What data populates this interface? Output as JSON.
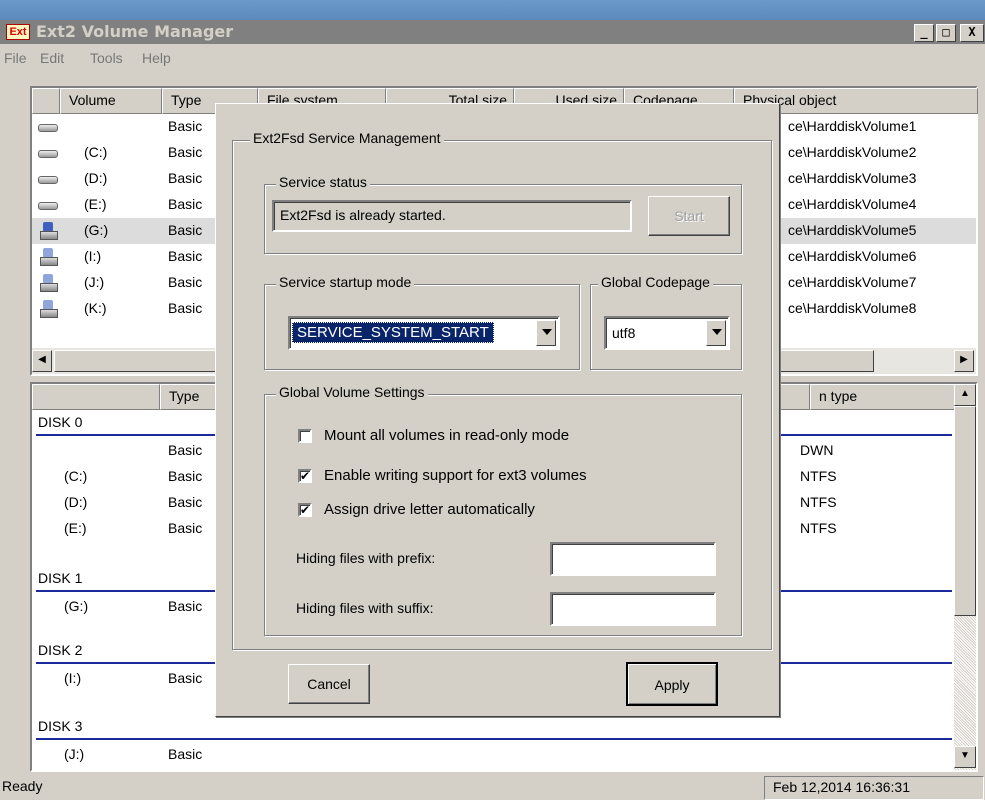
{
  "window": {
    "title": "Ext2 Volume Manager",
    "icon_text": "Ext"
  },
  "caption_buttons": {
    "minimize": "_",
    "maximize": "□",
    "close": "X"
  },
  "menu": [
    "File",
    "Edit",
    "Tools",
    "Help"
  ],
  "volume_table": {
    "headers": [
      "Volume",
      "Type",
      "File system",
      "Total size",
      "Used size",
      "Codepage",
      "Physical object"
    ],
    "rows": [
      {
        "volume": "",
        "type": "Basic",
        "physical": "ce\\HarddiskVolume1",
        "icon": "hard-disk-icon"
      },
      {
        "volume": "(C:)",
        "type": "Basic",
        "physical": "ce\\HarddiskVolume2",
        "icon": "hard-disk-icon"
      },
      {
        "volume": "(D:)",
        "type": "Basic",
        "physical": "ce\\HarddiskVolume3",
        "icon": "hard-disk-icon"
      },
      {
        "volume": "(E:)",
        "type": "Basic",
        "physical": "ce\\HarddiskVolume4",
        "icon": "hard-disk-icon"
      },
      {
        "volume": "(G:)",
        "type": "Basic",
        "physical": "ce\\HarddiskVolume5",
        "icon": "usb-disk-icon"
      },
      {
        "volume": "(I:)",
        "type": "Basic",
        "physical": "ce\\HarddiskVolume6",
        "icon": "usb-disk-icon"
      },
      {
        "volume": "(J:)",
        "type": "Basic",
        "physical": "ce\\HarddiskVolume7",
        "icon": "usb-disk-icon"
      },
      {
        "volume": "(K:)",
        "type": "Basic",
        "physical": "ce\\HarddiskVolume8",
        "icon": "usb-disk-icon"
      }
    ]
  },
  "disk_table": {
    "headers": [
      "",
      "Type",
      "",
      "n type"
    ],
    "disk0": "DISK 0",
    "disk1": "DISK 1",
    "disk2": "DISK 2",
    "disk3": "DISK 3",
    "rows": [
      {
        "name": "",
        "type": "Basic",
        "ptype": "DWN"
      },
      {
        "name": "(C:)",
        "type": "Basic",
        "ptype": "NTFS"
      },
      {
        "name": "(D:)",
        "type": "Basic",
        "ptype": "NTFS"
      },
      {
        "name": "(E:)",
        "type": "Basic",
        "ptype": "NTFS"
      },
      {
        "name": "(G:)",
        "type": "Basic",
        "ptype": ""
      },
      {
        "name": "(I:)",
        "type": "Basic",
        "ptype": ""
      },
      {
        "name": "(J:)",
        "type": "Basic",
        "ptype": ""
      }
    ]
  },
  "dialog": {
    "group_title": "Ext2Fsd Service Management",
    "service_status_label": "Service status",
    "service_status_text": "Ext2Fsd is already started.",
    "start_button": "Start",
    "startup_mode_label": "Service startup mode",
    "startup_mode_value": "SERVICE_SYSTEM_START",
    "codepage_label": "Global Codepage",
    "codepage_value": "utf8",
    "volume_settings_label": "Global Volume Settings",
    "opt_readonly": "Mount all volumes in read-only mode",
    "opt_readonly_checked": false,
    "opt_ext3": "Enable writing support for ext3 volumes",
    "opt_ext3_checked": true,
    "opt_driveletter": "Assign drive letter automatically",
    "opt_driveletter_checked": true,
    "prefix_label": "Hiding files with prefix:",
    "prefix_value": "",
    "suffix_label": "Hiding files with suffix:",
    "suffix_value": "",
    "cancel_button": "Cancel",
    "apply_button": "Apply"
  },
  "status": {
    "left": "Ready",
    "right": "Feb 12,2014 16:36:31"
  },
  "colors": {
    "selection": "#0a246a",
    "disk_line": "#1b2a9a",
    "titlebar": "#808080"
  }
}
